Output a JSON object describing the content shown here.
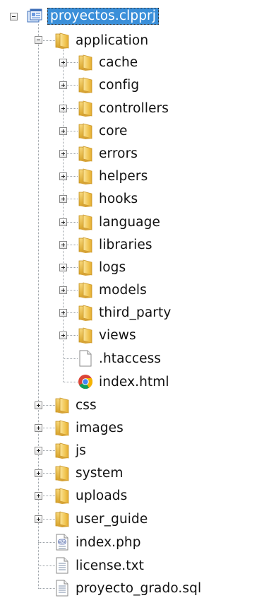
{
  "tree": {
    "root": {
      "label": "proyectos.clpprj",
      "icon": "project-icon",
      "expanded": true,
      "selected": true
    },
    "application": {
      "label": "application",
      "icon": "folder-icon",
      "expanded": true,
      "folders": [
        {
          "label": "cache",
          "icon": "folder-icon"
        },
        {
          "label": "config",
          "icon": "folder-icon"
        },
        {
          "label": "controllers",
          "icon": "folder-icon"
        },
        {
          "label": "core",
          "icon": "folder-icon"
        },
        {
          "label": "errors",
          "icon": "folder-icon"
        },
        {
          "label": "helpers",
          "icon": "folder-icon"
        },
        {
          "label": "hooks",
          "icon": "folder-icon"
        },
        {
          "label": "language",
          "icon": "folder-icon"
        },
        {
          "label": "libraries",
          "icon": "folder-icon"
        },
        {
          "label": "logs",
          "icon": "folder-icon"
        },
        {
          "label": "models",
          "icon": "folder-icon"
        },
        {
          "label": "third_party",
          "icon": "folder-icon"
        },
        {
          "label": "views",
          "icon": "folder-icon"
        }
      ],
      "files": [
        {
          "label": ".htaccess",
          "icon": "blank-file-icon"
        },
        {
          "label": "index.html",
          "icon": "chrome-html-icon"
        }
      ]
    },
    "top_folders": [
      {
        "label": "css",
        "icon": "folder-icon"
      },
      {
        "label": "images",
        "icon": "folder-icon"
      },
      {
        "label": "js",
        "icon": "folder-icon"
      },
      {
        "label": "system",
        "icon": "folder-icon"
      },
      {
        "label": "uploads",
        "icon": "folder-icon"
      },
      {
        "label": "user_guide",
        "icon": "folder-icon"
      }
    ],
    "top_files": [
      {
        "label": "index.php",
        "icon": "php-file-icon"
      },
      {
        "label": "license.txt",
        "icon": "text-file-icon"
      },
      {
        "label": "proyecto_grado.sql",
        "icon": "text-file-icon"
      }
    ]
  },
  "colors": {
    "selection": "#3a8fd9",
    "folder": "#f2c94c",
    "tree_line": "#9aa0a6"
  }
}
